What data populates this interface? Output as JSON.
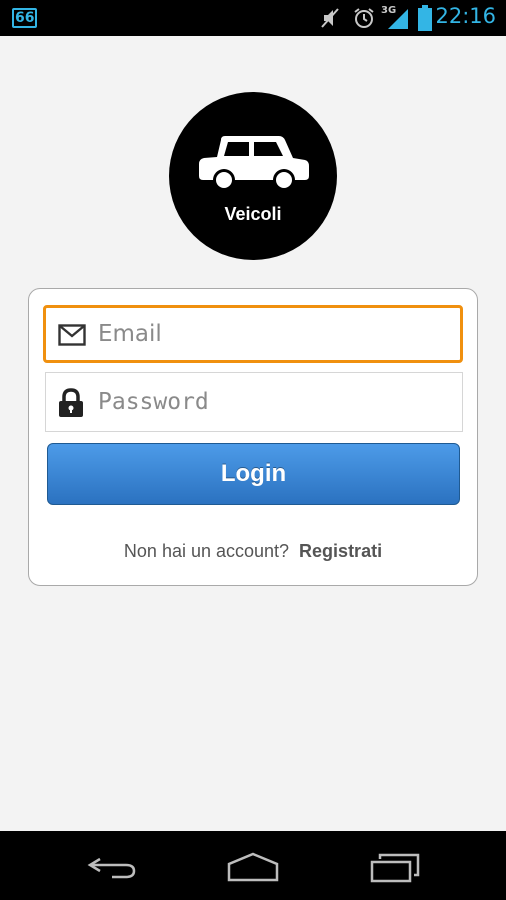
{
  "status_bar": {
    "notification_badge": "66",
    "network_type": "3G",
    "time": "22:16",
    "icons": [
      "notification-66-icon",
      "mute-icon",
      "alarm-icon",
      "signal-icon",
      "battery-icon"
    ],
    "accent_color": "#33b5e5"
  },
  "logo": {
    "label": "Veicoli",
    "icon": "car-icon"
  },
  "login_form": {
    "email": {
      "placeholder": "Email",
      "value": "",
      "icon": "envelope-icon",
      "focused": true
    },
    "password": {
      "placeholder": "Password",
      "value": "",
      "icon": "lock-icon"
    },
    "login_label": "Login",
    "register_prompt": "Non hai un account?",
    "register_link": "Registrati"
  },
  "nav_bar": {
    "buttons": [
      "back-icon",
      "home-icon",
      "recent-apps-icon"
    ]
  },
  "colors": {
    "focus_border": "#f0900f",
    "button_top": "#4d9be8",
    "button_bottom": "#2b72c0",
    "background": "#f3f3f3"
  }
}
